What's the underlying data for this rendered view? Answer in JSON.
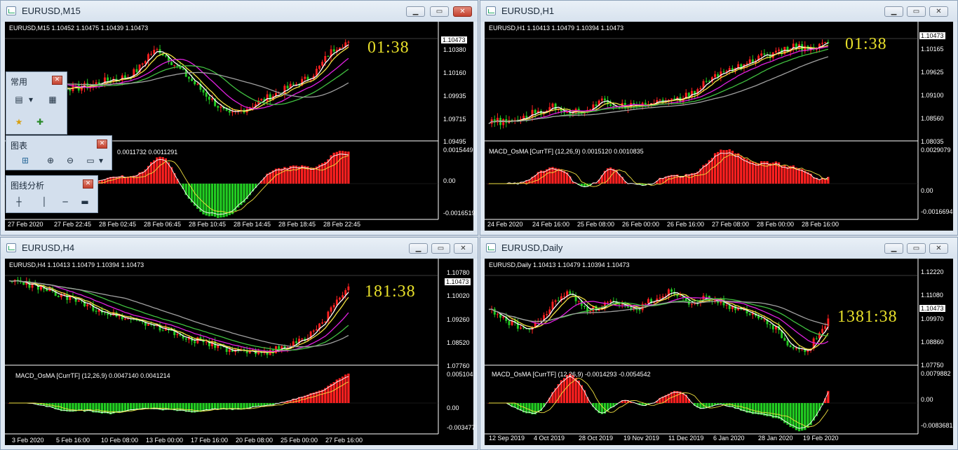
{
  "windows": [
    {
      "id": "m15",
      "title": "EURUSD,M15",
      "ohlc": "EURUSD,M15  1.10452 1.10475 1.10439 1.10473",
      "timer": "01:38",
      "macd_label": "0.0011732 0.0011291",
      "price_labels": [
        "1.10380",
        "1.10160",
        "1.09935",
        "1.09715",
        "1.09495"
      ],
      "current_price": "1.10473",
      "macd_labels": [
        "0.0015449",
        "0.00",
        "-0.0016519"
      ],
      "time_labels": [
        "27 Feb 2020",
        "27 Feb 22:45",
        "28 Feb 02:45",
        "28 Feb 06:45",
        "28 Feb 10:45",
        "28 Feb 14:45",
        "28 Feb 18:45",
        "28 Feb 22:45"
      ]
    },
    {
      "id": "h1",
      "title": "EURUSD,H1",
      "ohlc": "EURUSD,H1  1.10413 1.10479 1.10394 1.10473",
      "timer": "01:38",
      "macd_label": "MACD_OsMA [CurrTF] (12,26,9) 0.0015120 0.0010835",
      "price_labels": [
        "1.10165",
        "1.09625",
        "1.09100",
        "1.08560",
        "1.08035"
      ],
      "current_price": "1.10473",
      "macd_labels": [
        "0.0029079",
        "0.00",
        "-0.0016694"
      ],
      "time_labels": [
        "24 Feb 2020",
        "24 Feb 16:00",
        "25 Feb 08:00",
        "26 Feb 00:00",
        "26 Feb 16:00",
        "27 Feb 08:00",
        "28 Feb 00:00",
        "28 Feb 16:00"
      ]
    },
    {
      "id": "h4",
      "title": "EURUSD,H4",
      "ohlc": "EURUSD,H4  1.10413 1.10479 1.10394 1.10473",
      "timer": "181:38",
      "macd_label": "MACD_OsMA [CurrTF] (12,26,9) 0.0047140 0.0041214",
      "price_labels": [
        "1.10780",
        "1.10020",
        "1.09260",
        "1.08520",
        "1.07760"
      ],
      "current_price": "1.10473",
      "macd_labels": [
        "0.005104",
        "0.00",
        "-0.003477"
      ],
      "time_labels": [
        "3 Feb 2020",
        "5 Feb 16:00",
        "10 Feb 08:00",
        "13 Feb 00:00",
        "17 Feb 16:00",
        "20 Feb 08:00",
        "25 Feb 00:00",
        "27 Feb 16:00"
      ]
    },
    {
      "id": "d1",
      "title": "EURUSD,Daily",
      "ohlc": "EURUSD,Daily  1.10413 1.10479 1.10394 1.10473",
      "timer": "1381:38",
      "macd_label": "MACD_OsMA [CurrTF] (12,26,9) -0.0014293 -0.0054542",
      "price_labels": [
        "1.12220",
        "1.11080",
        "1.09970",
        "1.08860",
        "1.07750"
      ],
      "current_price": "1.10473",
      "macd_labels": [
        "0.0079882",
        "0.00",
        "-0.0083681"
      ],
      "time_labels": [
        "12 Sep 2019",
        "4 Oct 2019",
        "28 Oct 2019",
        "19 Nov 2019",
        "11 Dec 2019",
        "6 Jan 2020",
        "28 Jan 2020",
        "19 Feb 2020"
      ]
    }
  ],
  "toolbars": {
    "common": {
      "title": "常用"
    },
    "charts": {
      "title": "图表"
    },
    "analysis": {
      "title": "图线分析"
    }
  },
  "colors": {
    "bull": "#ff2020",
    "bear": "#22cc22",
    "ma_white": "#ffffff",
    "ma_yellow": "#f0e040",
    "ma_magenta": "#e020e0",
    "ma_green": "#40c040",
    "ma_gray": "#a0a0a0",
    "timer": "#e8e02a"
  }
}
